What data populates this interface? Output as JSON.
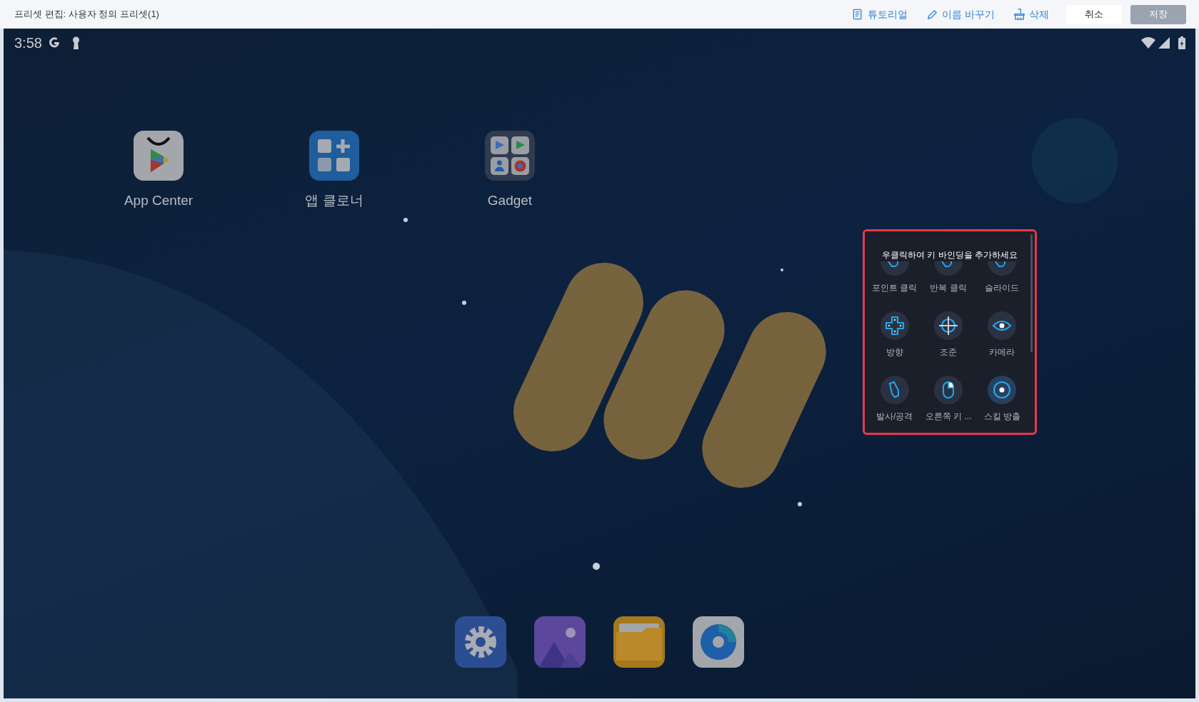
{
  "window": {
    "title": "프리셋 편집: 사용자 정의 프리셋(1)"
  },
  "toolbar": {
    "actions": [
      {
        "label": "튜토리얼"
      },
      {
        "label": "이름 바꾸기"
      },
      {
        "label": "삭제"
      }
    ],
    "buttons": [
      {
        "label": "취소",
        "disabled": false
      },
      {
        "label": "저장",
        "disabled": true
      }
    ]
  },
  "status_bar": {
    "time": "3:58"
  },
  "home_apps": [
    {
      "label": "App Center"
    },
    {
      "label": "앱 클로너"
    },
    {
      "label": "Gadget"
    }
  ],
  "key_panel": {
    "hint": "우클릭하여 키 바인딩을 추가하세요",
    "items": [
      {
        "label": "포인트 클릭"
      },
      {
        "label": "반복 클릭"
      },
      {
        "label": "슬라이드"
      },
      {
        "label": "방향"
      },
      {
        "label": "조준"
      },
      {
        "label": "카메라"
      },
      {
        "label": "발사/공격"
      },
      {
        "label": "오른쪽 키 ..."
      },
      {
        "label": "스킬 방출"
      }
    ]
  }
}
